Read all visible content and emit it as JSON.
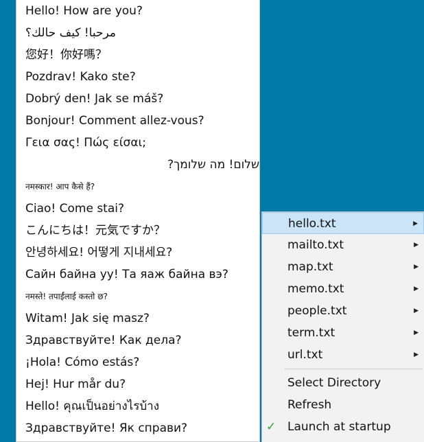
{
  "submenu": {
    "items": [
      "Hello! How are you?",
      "مرحبا! كيف حالك؟",
      "您好！你好嗎？",
      "Pozdrav! Kako ste?",
      "Dobrý den! Jak se máš?",
      "Bonjour! Comment allez-vous?",
      "Γεια σας! Πώς είσαι;",
      "שלום! מה שלומך?",
      "नमस्कार! आप कैसे हैं?",
      "Ciao! Come stai?",
      "こんにちは！元気ですか？",
      "안녕하세요! 어떻게 지내세요?",
      "Сайн байна уу! Та яаж байна вэ?",
      "नमस्ते! तपाईंलाई कस्तो छ?",
      "Witam! Jak się masz?",
      "Здравствуйте! Как дела?",
      "¡Hola! Cómo estás?",
      "Hej! Hur mår du?",
      "Hello! คุณเป็นอย่างไรบ้าง",
      "Здравствуйте! Як справи?"
    ]
  },
  "mainmenu": {
    "files": [
      "hello.txt",
      "mailto.txt",
      "map.txt",
      "memo.txt",
      "people.txt",
      "term.txt",
      "url.txt"
    ],
    "active_file": "hello.txt",
    "select_directory": "Select Directory",
    "refresh": "Refresh",
    "launch_at_startup": "Launch at startup",
    "launch_checked": true
  },
  "colors": {
    "desktop": "#0078a8",
    "highlight": "#cce4f7",
    "check": "#2aa52a"
  }
}
